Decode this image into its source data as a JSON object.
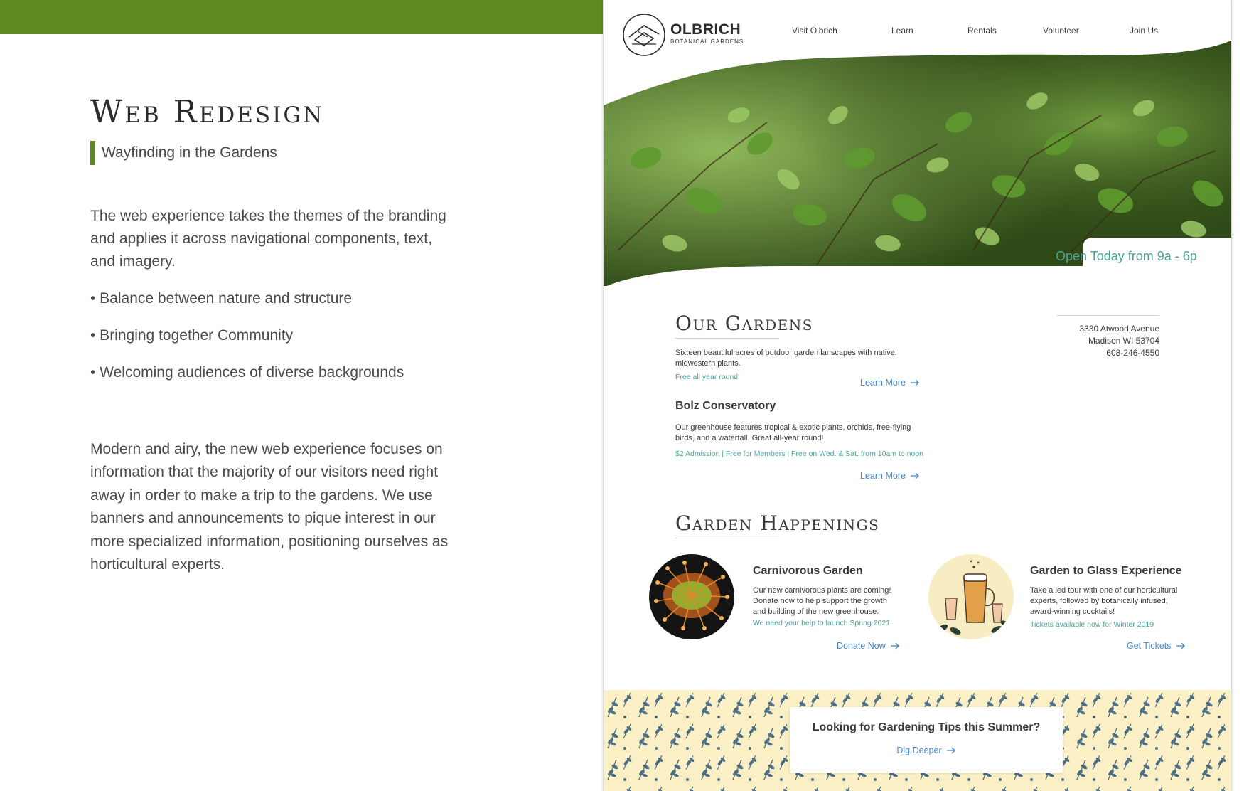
{
  "colors": {
    "brand_green": "#5e8b1f",
    "teal": "#4aa49a",
    "link_blue": "#4a86c5",
    "text_dark": "#3a3a3a",
    "pattern_bg": "#fbefc6",
    "pattern_leaf": "#4d6f85"
  },
  "case_study": {
    "title": "Web Redesign",
    "subtitle": "Wayfinding in the Gardens",
    "intro": "The web experience takes the themes of the branding and applies it across navigational components, text, and imagery.",
    "bullets": [
      "• Balance between nature and structure",
      "• Bringing together Community",
      "• Welcoming audiences of diverse backgrounds"
    ],
    "summary": "Modern and airy, the new web experience focuses on information that the majority of our visitors need right away in order to make a trip to the gardens. We use banners and announcements to pique interest in our more specialized information, positioning ourselves as horticultural experts."
  },
  "site": {
    "brand": {
      "name": "OLBRICH",
      "sub": "BOTANICAL GARDENS",
      "logo_icon": "olbrich-logo-icon"
    },
    "nav": [
      "Visit Olbrich",
      "Learn",
      "Rentals",
      "Volunteer",
      "Join Us"
    ],
    "hero": {
      "image": "green-leaves-photo",
      "open_hours": "Open Today from 9a - 6p"
    },
    "address": {
      "street": "3330 Atwood Avenue",
      "city": "Madison WI 53704",
      "phone": "608-246-4550"
    },
    "our_gardens": {
      "title": "Our Gardens",
      "description": "Sixteen beautiful acres of outdoor garden lanscapes with native, midwestern plants.",
      "note": "Free all year round!",
      "cta": "Learn More"
    },
    "conservatory": {
      "title": "Bolz Conservatory",
      "description": "Our greenhouse features tropical & exotic plants, orchids, free-flying birds, and a waterfall. Great all-year round!",
      "note": "$2 Admission | Free for Members | Free on Wed. & Sat. from 10am to noon",
      "cta": "Learn More"
    },
    "happenings": {
      "title": "Garden Happenings",
      "items": [
        {
          "title": "Carnivorous Garden",
          "description": "Our new carnivorous plants are coming! Donate now to help support the growth and building of the new greenhouse.",
          "note": "We need your help to launch Spring 2021!",
          "cta": "Donate Now",
          "image": "sundew-plant-photo"
        },
        {
          "title": "Garden to Glass Experience",
          "description": "Take a led tour with one of our horticultural experts, followed by botanically infused, award-winning cocktails!",
          "note": "Tickets available now for Winter 2019",
          "cta": "Get Tickets",
          "image": "beer-glasses-illustration"
        }
      ]
    },
    "tips_banner": {
      "title": "Looking for Gardening Tips this Summer?",
      "cta": "Dig Deeper"
    }
  }
}
